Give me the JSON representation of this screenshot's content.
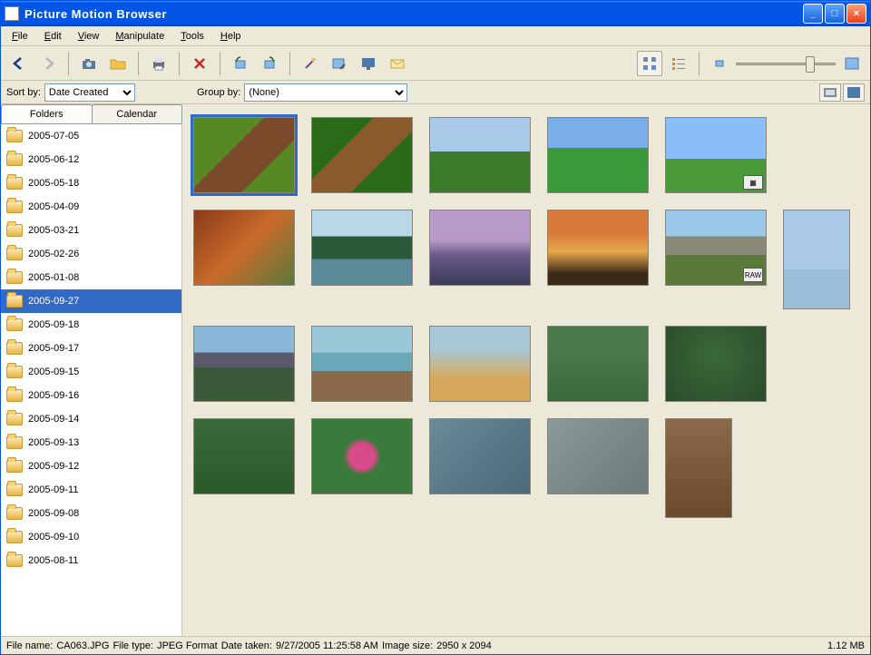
{
  "window": {
    "title": "Picture Motion Browser"
  },
  "menu": [
    "File",
    "Edit",
    "View",
    "Manipulate",
    "Tools",
    "Help"
  ],
  "sort": {
    "label": "Sort by:",
    "value": "Date Created"
  },
  "group": {
    "label": "Group by:",
    "value": "(None)"
  },
  "tabs": {
    "folders": "Folders",
    "calendar": "Calendar"
  },
  "folders": [
    {
      "name": "2005-07-05"
    },
    {
      "name": "2005-06-12"
    },
    {
      "name": "2005-05-18"
    },
    {
      "name": "2005-04-09"
    },
    {
      "name": "2005-03-21"
    },
    {
      "name": "2005-02-26"
    },
    {
      "name": "2005-01-08"
    },
    {
      "name": "2005-09-27",
      "selected": true
    },
    {
      "name": "2005-09-18"
    },
    {
      "name": "2005-09-17"
    },
    {
      "name": "2005-09-15"
    },
    {
      "name": "2005-09-16"
    },
    {
      "name": "2005-09-14"
    },
    {
      "name": "2005-09-13"
    },
    {
      "name": "2005-09-12"
    },
    {
      "name": "2005-09-11"
    },
    {
      "name": "2005-09-08"
    },
    {
      "name": "2005-09-10"
    },
    {
      "name": "2005-08-11"
    }
  ],
  "thumbs": [
    {
      "art": "tdog",
      "selected": true
    },
    {
      "art": "tcat"
    },
    {
      "art": "tfield"
    },
    {
      "art": "thouse"
    },
    {
      "art": "ttree",
      "badge": "▦"
    },
    {
      "art": "tautumn"
    },
    {
      "art": "tlake"
    },
    {
      "art": "tsunset1"
    },
    {
      "art": "tsunset2"
    },
    {
      "art": "tmtn",
      "badge": "RAW"
    },
    {
      "art": "tbranch",
      "portrait": true
    },
    {
      "art": "tteton"
    },
    {
      "art": "tspring"
    },
    {
      "art": "tgeyser"
    },
    {
      "art": "tbird1"
    },
    {
      "art": "tbird2"
    },
    {
      "art": "tbird3"
    },
    {
      "art": "tflower"
    },
    {
      "art": "tbird4"
    },
    {
      "art": "tbird5"
    },
    {
      "art": "tbrown",
      "portrait": true
    }
  ],
  "status": {
    "filename_label": "File name:",
    "filename": "CA063.JPG",
    "filetype_label": "File type:",
    "filetype": "JPEG Format",
    "datetaken_label": "Date taken:",
    "datetaken": "9/27/2005 11:25:58 AM",
    "imagesize_label": "Image size:",
    "imagesize": "2950 x 2094",
    "filesize": "1.12 MB"
  }
}
